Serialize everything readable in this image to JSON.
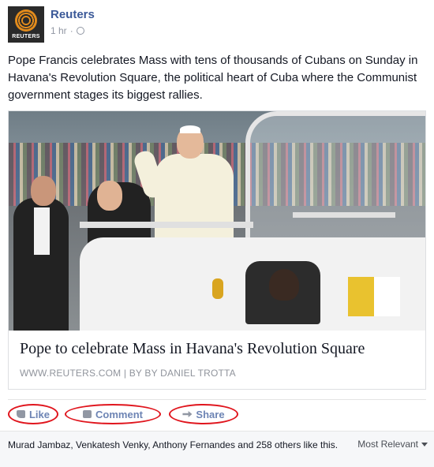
{
  "post": {
    "page_name": "Reuters",
    "avatar_text": "REUTERS",
    "time": "1 hr",
    "separator": "·",
    "text": "Pope Francis celebrates Mass with tens of thousands of Cubans on Sunday in Havana's Revolution Square, the political heart of Cuba where the Communist government stages its biggest rallies."
  },
  "link": {
    "title": "Pope to celebrate Mass in Havana's Revolution Square",
    "source": "WWW.REUTERS.COM | BY BY DANIEL TROTTA"
  },
  "actions": {
    "like": "Like",
    "comment": "Comment",
    "share": "Share"
  },
  "likes": {
    "text": "Murad Jambaz, Venkatesh Venky, Anthony Fernandes and 258 others like this.",
    "sort_label": "Most Relevant"
  },
  "colors": {
    "link_blue": "#3b5998",
    "action_blue": "#6d84b4",
    "annotation_red": "#e0151d",
    "brand_orange": "#e28b1c"
  }
}
